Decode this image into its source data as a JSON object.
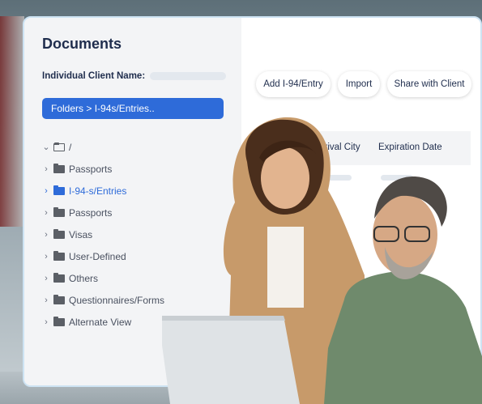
{
  "sidebar": {
    "title": "Documents",
    "client_label": "Individual Client Name:",
    "folder_path": "Folders > I-94s/Entries..",
    "root_label": "/",
    "items": [
      {
        "label": "Passports",
        "active": false
      },
      {
        "label": "I-94-s/Entries",
        "active": true
      },
      {
        "label": "Passports",
        "active": false
      },
      {
        "label": "Visas",
        "active": false
      },
      {
        "label": "User-Defined",
        "active": false
      },
      {
        "label": "Others",
        "active": false
      },
      {
        "label": "Questionnaires/Forms",
        "active": false
      },
      {
        "label": "Alternate View",
        "active": false
      }
    ]
  },
  "toolbar": {
    "add_label": "Add I-94/Entry",
    "import_label": "Import",
    "share_label": "Share with Client"
  },
  "table": {
    "columns": [
      "Arrival City",
      "Expiration Date"
    ]
  },
  "colors": {
    "accent": "#2e6bd9",
    "title": "#1f2d4d",
    "sidebar_bg": "#f3f4f6"
  },
  "icons": [
    "folder-icon",
    "folder-open-icon",
    "chevron-right-icon",
    "chevron-down-icon"
  ]
}
